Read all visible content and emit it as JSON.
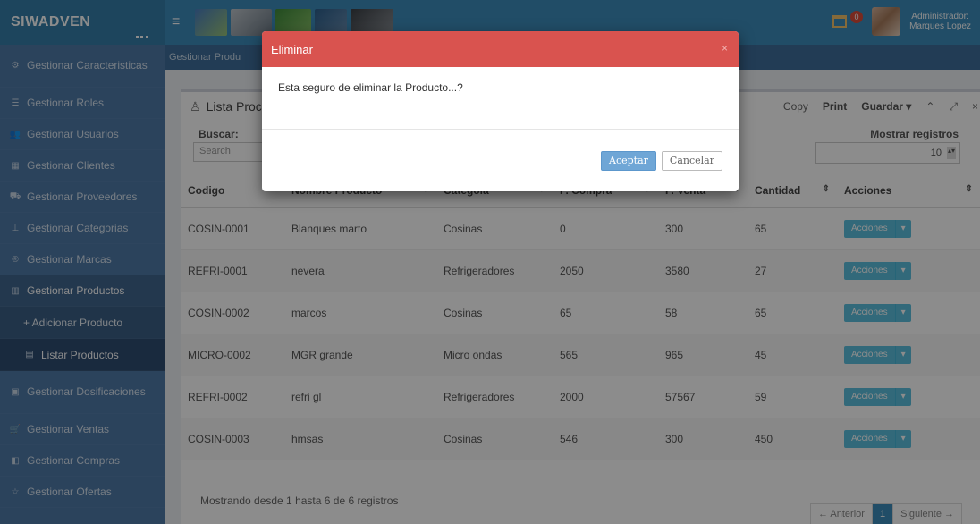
{
  "app": {
    "logo": "SIWADVEN"
  },
  "header": {
    "notification_count": "0",
    "user_role": "Administrador:",
    "user_name": "Marques Lopez"
  },
  "sidebar": {
    "items": [
      {
        "label": "Gestionar Caracteristicas",
        "icon": "gears-icon"
      },
      {
        "label": "Gestionar Roles",
        "icon": "list-icon"
      },
      {
        "label": "Gestionar Usuarios",
        "icon": "users-icon"
      },
      {
        "label": "Gestionar Clientes",
        "icon": "id-card-icon"
      },
      {
        "label": "Gestionar Proveedores",
        "icon": "truck-icon"
      },
      {
        "label": "Gestionar Categorias",
        "icon": "sitemap-icon"
      },
      {
        "label": "Gestionar Marcas",
        "icon": "registered-icon"
      },
      {
        "label": "Gestionar Productos",
        "icon": "barcode-icon"
      },
      {
        "label": "+ Adicionar Producto",
        "icon": ""
      },
      {
        "label": "Listar Productos",
        "icon": "table-icon"
      },
      {
        "label": "Gestionar Dosificaciones",
        "icon": "calendar-icon"
      },
      {
        "label": "Gestionar Ventas",
        "icon": "cart-icon"
      },
      {
        "label": "Gestionar Compras",
        "icon": "bag-icon"
      },
      {
        "label": "Gestionar Ofertas",
        "icon": "star-icon"
      }
    ]
  },
  "breadcrumb": "Gestionar Produ",
  "box": {
    "title": "Lista Proc",
    "tools": {
      "copy": "Copy",
      "print": "Print",
      "guardar": "Guardar ▾"
    },
    "search_label": "Buscar:",
    "search_placeholder": "Search",
    "records_label": "Mostrar registros",
    "records_value": "10"
  },
  "table": {
    "columns": [
      "Codigo",
      "Nombre Producto",
      "Categoia",
      "P. Compra",
      "P. Venta",
      "Cantidad",
      "Acciones"
    ],
    "rows": [
      [
        "COSIN-0001",
        "Blanques marto",
        "Cosinas",
        "0",
        "300",
        "65"
      ],
      [
        "REFRI-0001",
        "nevera",
        "Refrigeradores",
        "2050",
        "3580",
        "27"
      ],
      [
        "COSIN-0002",
        "marcos",
        "Cosinas",
        "65",
        "58",
        "65"
      ],
      [
        "MICRO-0002",
        "MGR grande",
        "Micro ondas",
        "565",
        "965",
        "45"
      ],
      [
        "REFRI-0002",
        "refri gl",
        "Refrigeradores",
        "2000",
        "57567",
        "59"
      ],
      [
        "COSIN-0003",
        "hmsas",
        "Cosinas",
        "546",
        "300",
        "450"
      ]
    ],
    "action_label": "Acciones"
  },
  "footer": {
    "showing": "Mostrando desde 1 hasta 6 de 6 registros",
    "prev": "← Anterior",
    "page": "1",
    "next": "Siguiente →"
  },
  "modal": {
    "title": "Eliminar",
    "close": "×",
    "message": "Esta seguro de eliminar la Producto...?",
    "ok": "Aceptar",
    "cancel": "Cancelar"
  },
  "colors": {
    "header": "#3c8dbc",
    "sidebar": "#4f7aa8",
    "modal_header": "#d9534f",
    "action_button": "#5bc0de"
  }
}
